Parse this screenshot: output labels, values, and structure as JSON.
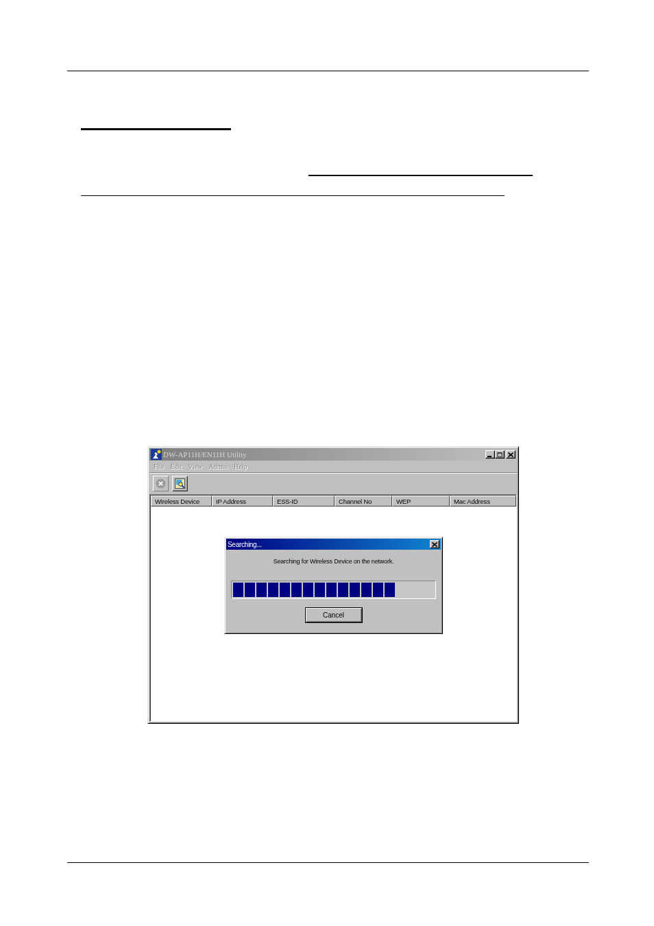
{
  "window": {
    "title": "DW-AP11H/EN11H Utility",
    "active": false
  },
  "menu": [
    {
      "label": "File",
      "disabled": true
    },
    {
      "label": "Edit",
      "disabled": true
    },
    {
      "label": "View",
      "disabled": true
    },
    {
      "label": "Admin",
      "disabled": true
    },
    {
      "label": "Help",
      "disabled": true
    }
  ],
  "toolbar": [
    {
      "kind": "stop",
      "disabled": true
    },
    {
      "kind": "search",
      "disabled": false
    }
  ],
  "list": {
    "columns": [
      "Wireless Device",
      "IP Address",
      "ESS-ID",
      "Channel No",
      "WEP",
      "Mac Address"
    ]
  },
  "dialog": {
    "title": "Searching...",
    "message": "Searching for Wireless Device on the network.",
    "progress": {
      "level": 0.81
    },
    "buttons": [
      {
        "label": "Cancel",
        "default": true
      }
    ]
  }
}
